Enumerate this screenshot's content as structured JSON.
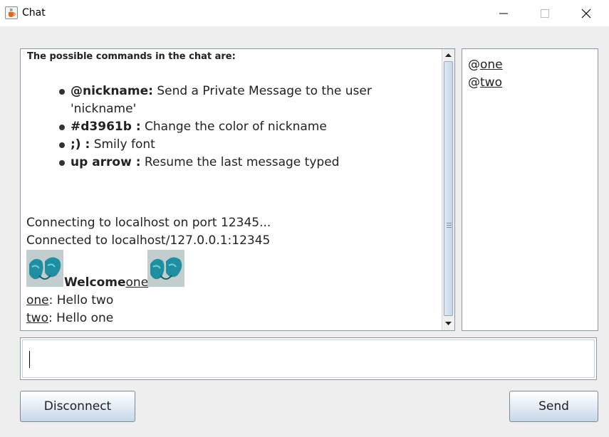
{
  "window": {
    "title": "Chat",
    "icon": "java-cup-icon",
    "controls": [
      "minimize",
      "maximize",
      "close"
    ]
  },
  "chat": {
    "commands_header": "The possible commands in the chat are:",
    "commands": [
      {
        "key": "@nickname:",
        "desc": " Send a Private Message to the user 'nickname'"
      },
      {
        "key": "#d3961b :",
        "desc": " Change the color of nickname"
      },
      {
        "key": ";) :",
        "desc": " Smily font"
      },
      {
        "key": "up arrow :",
        "desc": " Resume the last message typed"
      }
    ],
    "status_lines": [
      "Connecting to localhost on port 12345...",
      "Connected to localhost/127.0.0.1:12345"
    ],
    "welcome": {
      "text": "Welcome",
      "user": "one"
    },
    "messages": [
      {
        "user": "one",
        "text": ": Hello two"
      },
      {
        "user": "two",
        "text": ": Hello one"
      }
    ]
  },
  "users": [
    "@one",
    "@two"
  ],
  "input": {
    "value": ""
  },
  "buttons": {
    "disconnect": "Disconnect",
    "send": "Send"
  },
  "colors": {
    "accent": "#c6d6e8",
    "border": "#8b98a8",
    "emoji_teal": "#1f8ea0"
  }
}
